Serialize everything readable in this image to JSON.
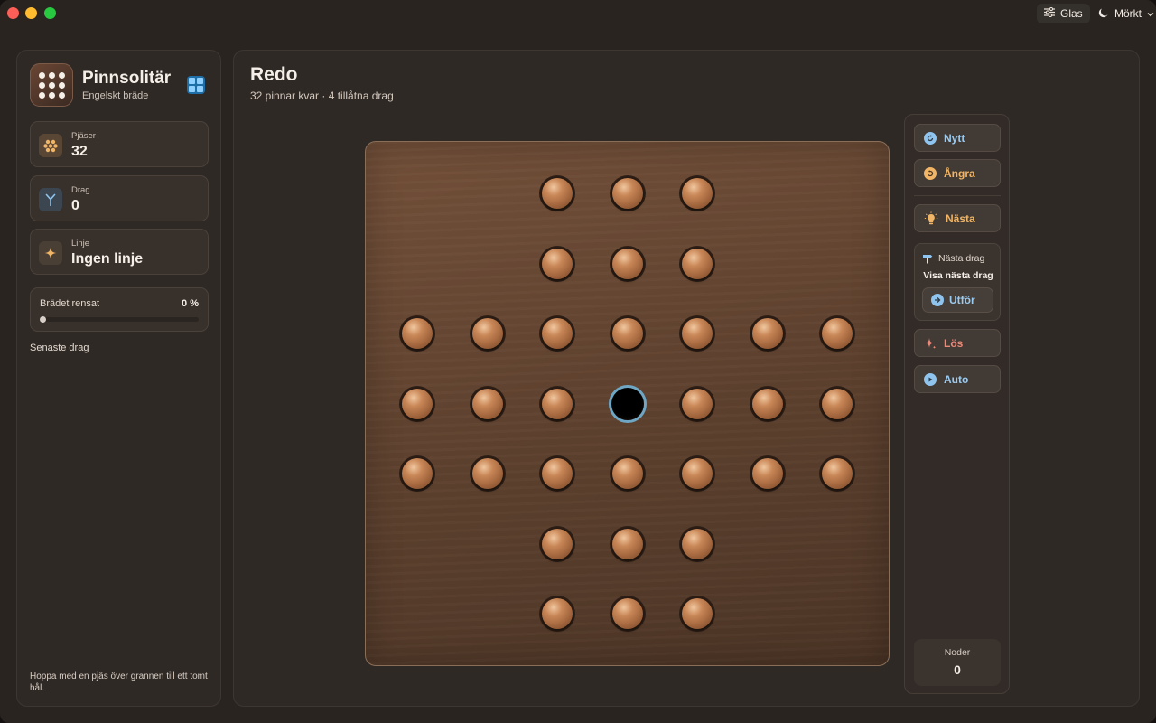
{
  "window": {
    "glas_label": "Glas",
    "dark_label": "Mörkt"
  },
  "sidebar": {
    "app_title": "Pinnsolitär",
    "app_subtitle": "Engelskt bräde",
    "stats": [
      {
        "label": "Pjäser",
        "value": "32"
      },
      {
        "label": "Drag",
        "value": "0"
      },
      {
        "label": "Linje",
        "value": "Ingen linje"
      }
    ],
    "progress": {
      "label": "Brädet rensat",
      "value": "0 %",
      "fraction": 0
    },
    "recent_label": "Senaste drag",
    "hint": "Hoppa med en pjäs över grannen till ett tomt hål."
  },
  "status": {
    "title": "Redo",
    "subtitle": "32 pinnar kvar · 4 tillåtna drag"
  },
  "board": {
    "size": 7,
    "layout": [
      "__ppp__",
      "__ppp__",
      "ppppppp",
      "pppoppp",
      "ppppppp",
      "__ppp__",
      "__ppp__"
    ],
    "legend": {
      "p": "peg",
      "o": "empty-hole",
      "_": "none"
    }
  },
  "controls": {
    "new_label": "Nytt",
    "undo_label": "Ångra",
    "next_label": "Nästa",
    "next_move_title": "Nästa drag",
    "next_move_desc": "Visa nästa drag",
    "run_label": "Utför",
    "solve_label": "Lös",
    "auto_label": "Auto",
    "nodes_label": "Noder",
    "nodes_value": "0"
  },
  "colors": {
    "accent_blue": "#8fc4ee",
    "accent_orange": "#f0b566",
    "accent_pink": "#ec8a7a",
    "board_wood": "#614330",
    "peg": "#b5754a",
    "hole_ring": "#6fa6c4"
  }
}
